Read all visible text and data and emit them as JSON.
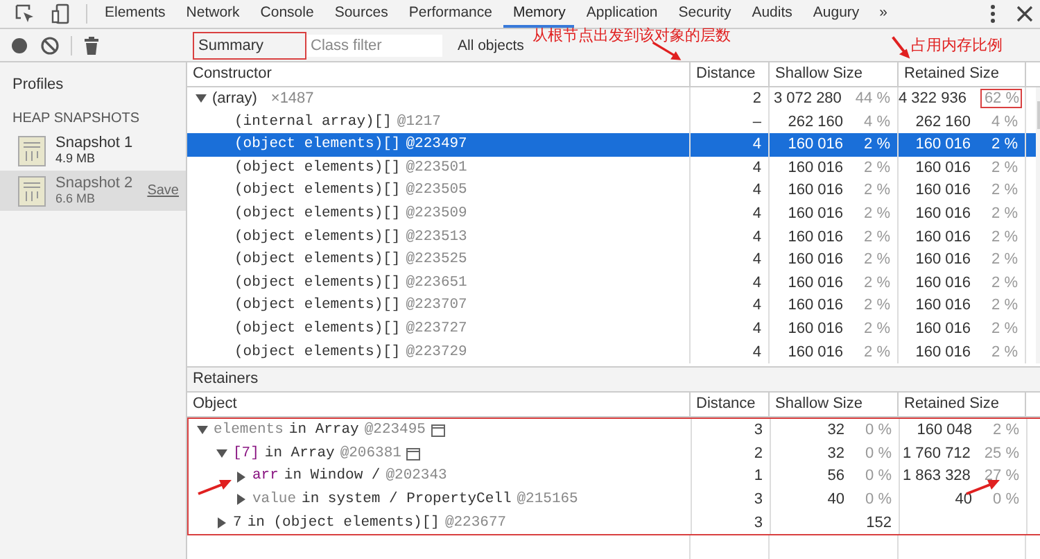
{
  "tabs": [
    {
      "label": "Elements",
      "selected": false
    },
    {
      "label": "Network",
      "selected": false
    },
    {
      "label": "Console",
      "selected": false
    },
    {
      "label": "Sources",
      "selected": false
    },
    {
      "label": "Performance",
      "selected": false
    },
    {
      "label": "Memory",
      "selected": true
    },
    {
      "label": "Application",
      "selected": false
    },
    {
      "label": "Security",
      "selected": false
    },
    {
      "label": "Audits",
      "selected": false
    },
    {
      "label": "Augury",
      "selected": false
    }
  ],
  "more_tabs": "»",
  "toolbar": {
    "view": "Summary",
    "view_highlighted": true,
    "class_filter": {
      "placeholder": "Class filter"
    },
    "objects": "All objects"
  },
  "sidebar": {
    "title": "Profiles",
    "section": "HEAP SNAPSHOTS",
    "snapshots": [
      {
        "name": "Snapshot 1",
        "size": "4.9 MB",
        "selected": false
      },
      {
        "name": "Snapshot 2",
        "size": "6.6 MB",
        "selected": true,
        "action": "Save"
      }
    ]
  },
  "table": {
    "columns": [
      "Constructor",
      "Distance",
      "Shallow Size",
      "Retained Size"
    ],
    "rows": [
      {
        "name": "(array)",
        "count": "×1487",
        "expanded": true,
        "distance": "2",
        "shallow": "3 072 280",
        "shallow_pct": "44 %",
        "retained": "4 322 936",
        "retained_pct": "62 %",
        "retained_highlighted": true,
        "selected": false,
        "children": [
          {
            "name": "(internal array)[]",
            "id": "@1217",
            "distance": "–",
            "shallow": "262 160",
            "shallow_pct": "4 %",
            "retained": "262 160",
            "retained_pct": "4 %",
            "selected": false
          },
          {
            "name": "(object elements)[]",
            "id": "@223497",
            "distance": "4",
            "shallow": "160 016",
            "shallow_pct": "2 %",
            "retained": "160 016",
            "retained_pct": "2 %",
            "selected": true
          },
          {
            "name": "(object elements)[]",
            "id": "@223501",
            "distance": "4",
            "shallow": "160 016",
            "shallow_pct": "2 %",
            "retained": "160 016",
            "retained_pct": "2 %",
            "selected": false
          },
          {
            "name": "(object elements)[]",
            "id": "@223505",
            "distance": "4",
            "shallow": "160 016",
            "shallow_pct": "2 %",
            "retained": "160 016",
            "retained_pct": "2 %",
            "selected": false
          },
          {
            "name": "(object elements)[]",
            "id": "@223509",
            "distance": "4",
            "shallow": "160 016",
            "shallow_pct": "2 %",
            "retained": "160 016",
            "retained_pct": "2 %",
            "selected": false
          },
          {
            "name": "(object elements)[]",
            "id": "@223513",
            "distance": "4",
            "shallow": "160 016",
            "shallow_pct": "2 %",
            "retained": "160 016",
            "retained_pct": "2 %",
            "selected": false
          },
          {
            "name": "(object elements)[]",
            "id": "@223525",
            "distance": "4",
            "shallow": "160 016",
            "shallow_pct": "2 %",
            "retained": "160 016",
            "retained_pct": "2 %",
            "selected": false
          },
          {
            "name": "(object elements)[]",
            "id": "@223651",
            "distance": "4",
            "shallow": "160 016",
            "shallow_pct": "2 %",
            "retained": "160 016",
            "retained_pct": "2 %",
            "selected": false
          },
          {
            "name": "(object elements)[]",
            "id": "@223707",
            "distance": "4",
            "shallow": "160 016",
            "shallow_pct": "2 %",
            "retained": "160 016",
            "retained_pct": "2 %",
            "selected": false
          },
          {
            "name": "(object elements)[]",
            "id": "@223727",
            "distance": "4",
            "shallow": "160 016",
            "shallow_pct": "2 %",
            "retained": "160 016",
            "retained_pct": "2 %",
            "selected": false
          },
          {
            "name": "(object elements)[]",
            "id": "@223729",
            "distance": "4",
            "shallow": "160 016",
            "shallow_pct": "2 %",
            "retained": "160 016",
            "retained_pct": "2 %",
            "selected": false
          }
        ]
      }
    ]
  },
  "retainers": {
    "title": "Retainers",
    "highlighted": true,
    "columns": [
      "Object",
      "Distance",
      "Shallow Size",
      "Retained Size"
    ],
    "rows": [
      {
        "edge": "elements",
        "kind": "internal",
        "owner": "in Array",
        "id": "@223495",
        "expanded": true,
        "distance": "3",
        "shallow": "32",
        "shallow_pct": "0 %",
        "retained": "160 048",
        "retained_pct": "2 %",
        "children": [
          {
            "edge": "[7]",
            "kind": "named",
            "owner": "in Array",
            "id": "@206381",
            "expanded": true,
            "distance": "2",
            "shallow": "32",
            "shallow_pct": "0 %",
            "retained": "1 760 712",
            "retained_pct": "25 %",
            "children": [
              {
                "edge": "arr",
                "kind": "named",
                "owner": "in Window /",
                "id": "@202343",
                "expanded": false,
                "distance": "1",
                "shallow": "56",
                "shallow_pct": "0 %",
                "retained": "1 863 328",
                "retained_pct": "27 %"
              },
              {
                "edge": "value",
                "kind": "internal",
                "owner": "in system / PropertyCell",
                "id": "@215165",
                "expanded": false,
                "distance": "3",
                "shallow": "40",
                "shallow_pct": "0 %",
                "retained": "40",
                "retained_pct": "0 %"
              }
            ]
          },
          {
            "edge": "7",
            "kind": "plain",
            "owner": "in (object elements)[]",
            "id": "@223677",
            "expanded": false,
            "distance": "3",
            "shallow": "152"
          }
        ]
      }
    ]
  },
  "annotations": [
    "从根节点出发到该对象的层数",
    "占用内存比例"
  ]
}
